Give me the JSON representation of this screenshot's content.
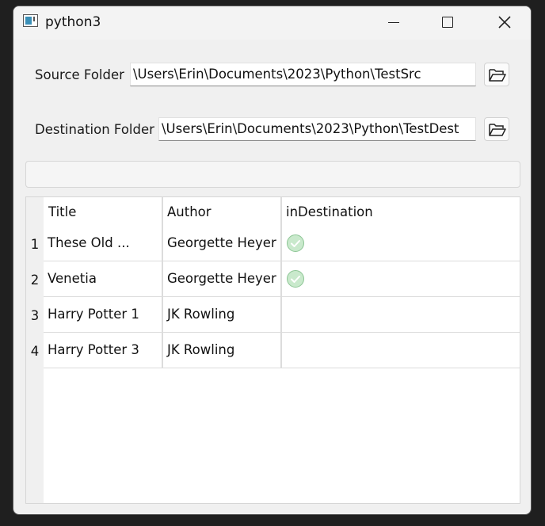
{
  "window": {
    "title": "python3"
  },
  "source": {
    "label": "Source Folder",
    "path": "\\Users\\Erin\\Documents\\2023\\Python\\TestSrc"
  },
  "destination": {
    "label": "Destination Folder",
    "path": "\\Users\\Erin\\Documents\\2023\\Python\\TestDest"
  },
  "progress": {
    "value": 0
  },
  "table": {
    "columns": [
      "Title",
      "Author",
      "inDestination"
    ],
    "rows": [
      {
        "num": "1",
        "title": "These Old ...",
        "author": "Georgette Heyer",
        "in_destination": true
      },
      {
        "num": "2",
        "title": "Venetia",
        "author": "Georgette Heyer",
        "in_destination": true
      },
      {
        "num": "3",
        "title": "Harry Potter 1",
        "author": "JK Rowling",
        "in_destination": false
      },
      {
        "num": "4",
        "title": "Harry Potter 3",
        "author": "JK Rowling",
        "in_destination": false
      }
    ]
  },
  "icons": {
    "app": "window-app-icon",
    "minimize": "minimize-icon",
    "maximize": "maximize-icon",
    "close": "close-icon",
    "browse": "folder-open-icon",
    "check": "check-circle-icon"
  },
  "colors": {
    "check_fill": "#c9e9cc",
    "check_stroke": "#7dbd86",
    "window_bg": "#f0f0f0"
  }
}
